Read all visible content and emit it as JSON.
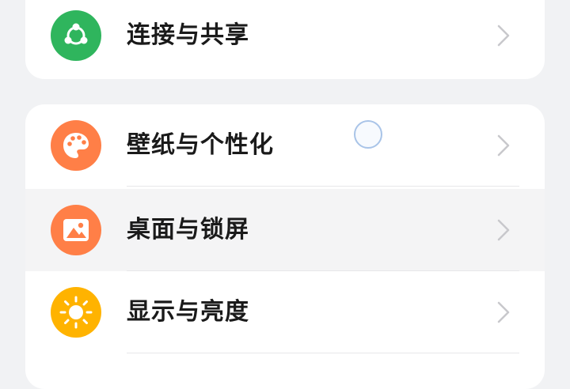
{
  "settings": {
    "top_group": [
      {
        "label": "连接与共享",
        "icon": "share-icon",
        "color": "#2fb55d"
      }
    ],
    "main_group": [
      {
        "label": "壁纸与个性化",
        "icon": "palette-icon",
        "color": "#ff7f47"
      },
      {
        "label": "桌面与锁屏",
        "icon": "image-icon",
        "color": "#ff7f47"
      },
      {
        "label": "显示与亮度",
        "icon": "sun-icon",
        "color": "#ffb300"
      }
    ]
  },
  "colors": {
    "background": "#f1f2f4",
    "card": "#ffffff",
    "chevron": "#c8c8cc",
    "pressed_row": "#f4f4f5"
  }
}
